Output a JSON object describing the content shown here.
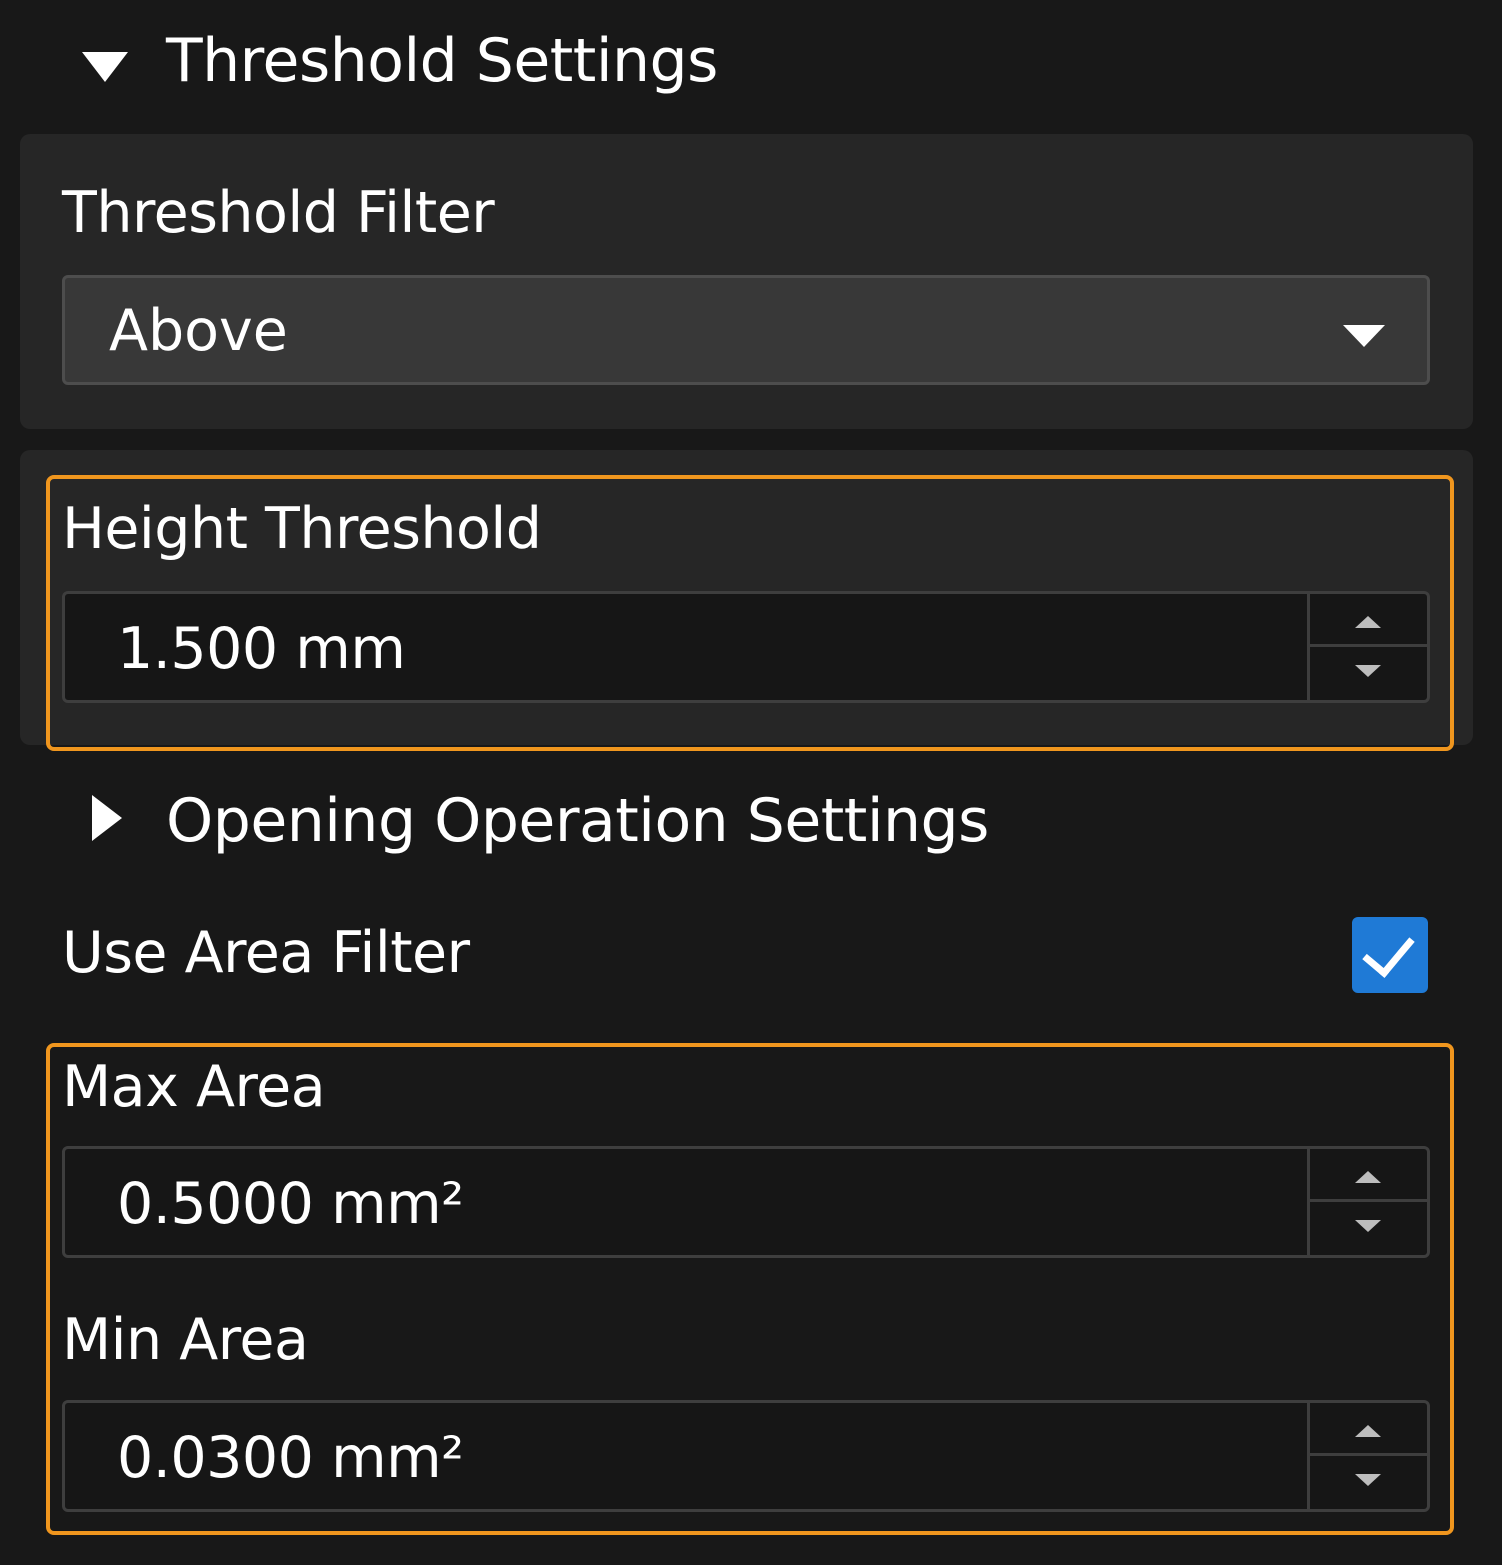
{
  "threshold_section": {
    "title": "Threshold Settings",
    "expanded": true,
    "icon": "triangle-down-icon"
  },
  "threshold_filter": {
    "label": "Threshold Filter",
    "selected": "Above",
    "icon": "dropdown-arrow-icon"
  },
  "height_threshold": {
    "label": "Height Threshold",
    "value": "1.500 mm"
  },
  "opening_section": {
    "title": "Opening Operation Settings",
    "expanded": false,
    "icon": "triangle-right-icon"
  },
  "area_filter": {
    "label": "Use Area Filter",
    "checked": true
  },
  "max_area": {
    "label": "Max Area",
    "value": "0.5000 mm²"
  },
  "min_area": {
    "label": "Min Area",
    "value": "0.0300 mm²"
  },
  "colors": {
    "background": "#181818",
    "card": "#262626",
    "highlight": "#f0961e",
    "checkbox": "#1f7ad6"
  }
}
